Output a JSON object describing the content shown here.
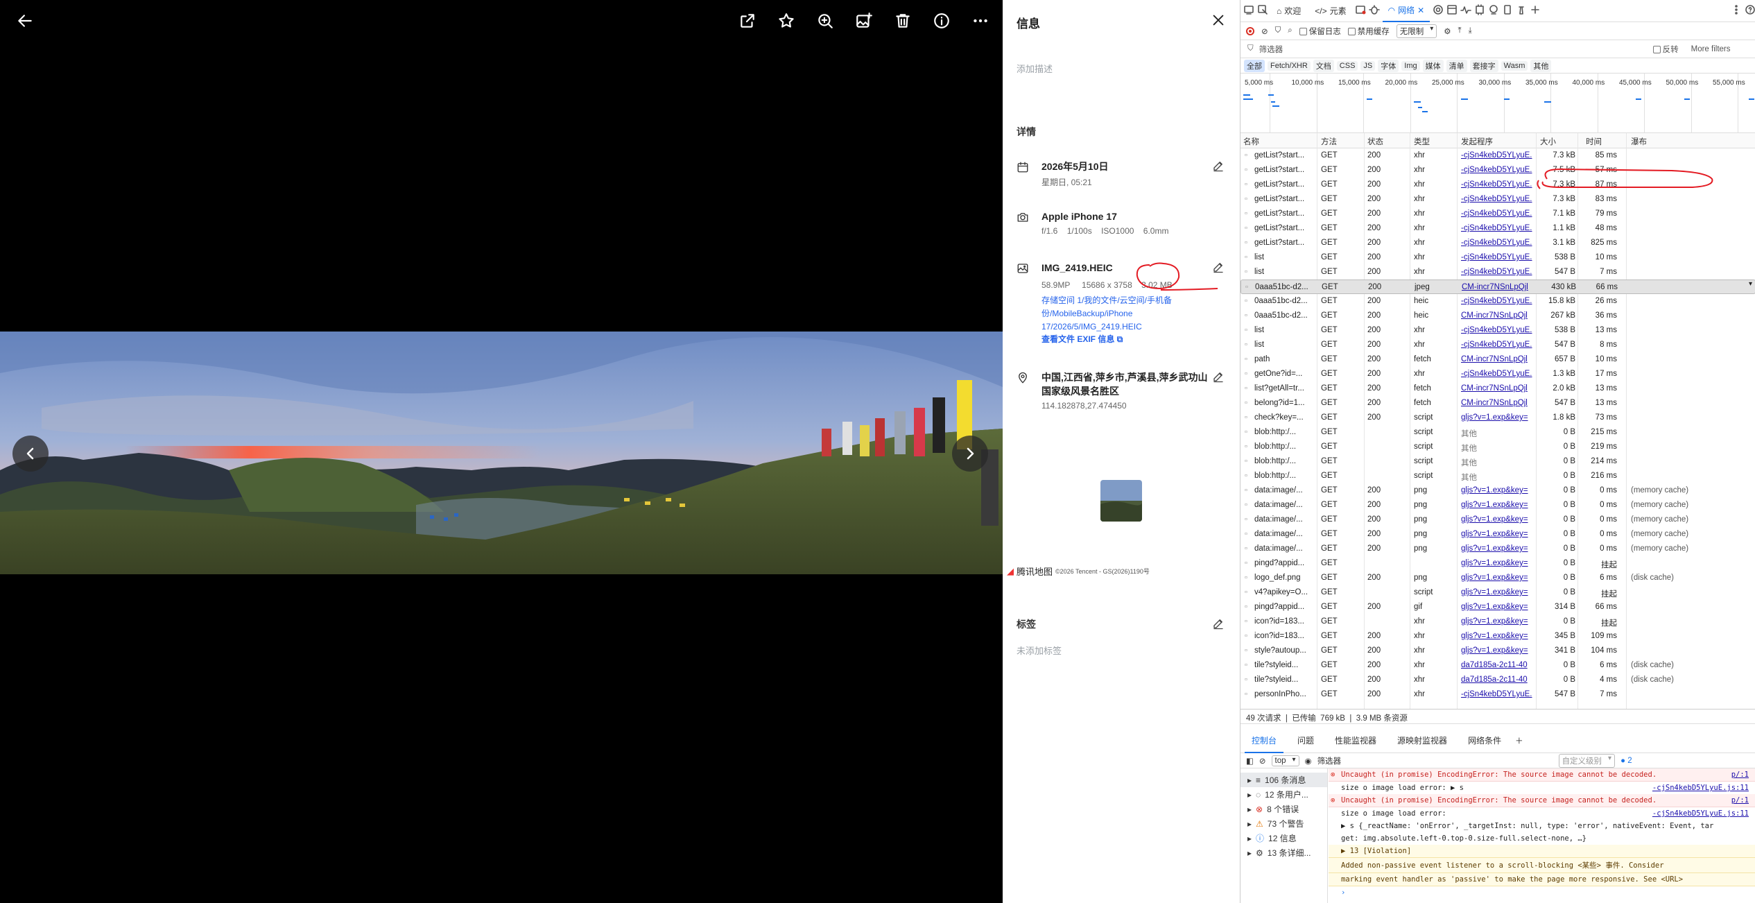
{
  "viewer": {
    "toolbar_icons": [
      "back-arrow-icon",
      "share-icon",
      "star-icon",
      "zoom-in-icon",
      "add-to-album-icon",
      "trash-icon",
      "info-icon",
      "more-icon"
    ]
  },
  "info": {
    "title": "信息",
    "description_placeholder": "添加描述",
    "details_heading": "详情",
    "date": "2026年5月10日",
    "date_sub": "星期日, 05:21",
    "camera": "Apple iPhone 17",
    "camera_params": [
      "f/1.6",
      "1/100s",
      "ISO1000",
      "6.0mm"
    ],
    "file_name": "IMG_2419.HEIC",
    "file_params": [
      "58.9MP",
      "15686 x 3758",
      "3.02 MB"
    ],
    "file_path": "存储空间 1/我的文件/云空间/手机备份/MobileBackup/iPhone 17/2026/5/IMG_2419.HEIC",
    "exif_link": "查看文件 EXIF 信息",
    "location": "中国,江西省,萍乡市,芦溪县,萍乡武功山国家级风景名胜区",
    "coords": "114.182878,27.474450",
    "map_brand": "腾讯地图",
    "map_copyright": "©2026 Tencent - GS(2026)1190号",
    "tags_heading": "标签",
    "tags_placeholder": "未添加标签"
  },
  "devtools": {
    "tabs": [
      "欢迎",
      "元素",
      "网络"
    ],
    "toolbar": {
      "preserve_log": "保留日志",
      "disable_cache": "禁用缓存",
      "throttle": "无限制"
    },
    "filter": {
      "placeholder": "筛选器",
      "invert": "反转",
      "more": "More filters"
    },
    "types": [
      "全部",
      "Fetch/XHR",
      "文档",
      "CSS",
      "JS",
      "字体",
      "Img",
      "媒体",
      "清单",
      "套接字",
      "Wasm",
      "其他"
    ],
    "timeline_ticks": [
      "5,000 ms",
      "10,000 ms",
      "15,000 ms",
      "20,000 ms",
      "25,000 ms",
      "30,000 ms",
      "35,000 ms",
      "40,000 ms",
      "45,000 ms",
      "50,000 ms",
      "55,000 ms"
    ],
    "columns": [
      "名称",
      "方法",
      "状态",
      "类型",
      "发起程序",
      "大小",
      "时间",
      "瀑布"
    ],
    "rows": [
      [
        "getList?start...",
        "GET",
        "200",
        "xhr",
        "-cjSn4kebD5YLyuE.",
        "7.3 kB",
        "85 ms",
        ""
      ],
      [
        "getList?start...",
        "GET",
        "200",
        "xhr",
        "-cjSn4kebD5YLyuE.",
        "7.5 kB",
        "57 ms",
        ""
      ],
      [
        "getList?start...",
        "GET",
        "200",
        "xhr",
        "-cjSn4kebD5YLyuE.",
        "7.3 kB",
        "87 ms",
        ""
      ],
      [
        "getList?start...",
        "GET",
        "200",
        "xhr",
        "-cjSn4kebD5YLyuE.",
        "7.3 kB",
        "83 ms",
        ""
      ],
      [
        "getList?start...",
        "GET",
        "200",
        "xhr",
        "-cjSn4kebD5YLyuE.",
        "7.1 kB",
        "79 ms",
        ""
      ],
      [
        "getList?start...",
        "GET",
        "200",
        "xhr",
        "-cjSn4kebD5YLyuE.",
        "1.1 kB",
        "48 ms",
        ""
      ],
      [
        "getList?start...",
        "GET",
        "200",
        "xhr",
        "-cjSn4kebD5YLyuE.",
        "3.1 kB",
        "825 ms",
        ""
      ],
      [
        "list",
        "GET",
        "200",
        "xhr",
        "-cjSn4kebD5YLyuE.",
        "538 B",
        "10 ms",
        ""
      ],
      [
        "list",
        "GET",
        "200",
        "xhr",
        "-cjSn4kebD5YLyuE.",
        "547 B",
        "7 ms",
        ""
      ],
      [
        "0aaa51bc-d2...",
        "GET",
        "200",
        "jpeg",
        "CM-incr7NSnLpQjl",
        "430 kB",
        "66 ms",
        ""
      ],
      [
        "0aaa51bc-d2...",
        "GET",
        "200",
        "heic",
        "-cjSn4kebD5YLyuE.",
        "15.8 kB",
        "26 ms",
        ""
      ],
      [
        "0aaa51bc-d2...",
        "GET",
        "200",
        "heic",
        "CM-incr7NSnLpQjl",
        "267 kB",
        "36 ms",
        ""
      ],
      [
        "list",
        "GET",
        "200",
        "xhr",
        "-cjSn4kebD5YLyuE.",
        "538 B",
        "13 ms",
        ""
      ],
      [
        "list",
        "GET",
        "200",
        "xhr",
        "-cjSn4kebD5YLyuE.",
        "547 B",
        "8 ms",
        ""
      ],
      [
        "path",
        "GET",
        "200",
        "fetch",
        "CM-incr7NSnLpQjl",
        "657 B",
        "10 ms",
        ""
      ],
      [
        "getOne?id=...",
        "GET",
        "200",
        "xhr",
        "-cjSn4kebD5YLyuE.",
        "1.3 kB",
        "17 ms",
        ""
      ],
      [
        "list?getAll=tr...",
        "GET",
        "200",
        "fetch",
        "CM-incr7NSnLpQjl",
        "2.0 kB",
        "13 ms",
        ""
      ],
      [
        "belong?id=1...",
        "GET",
        "200",
        "fetch",
        "CM-incr7NSnLpQjl",
        "547 B",
        "13 ms",
        ""
      ],
      [
        "check?key=...",
        "GET",
        "200",
        "script",
        "gljs?v=1.exp&key=",
        "1.8 kB",
        "73 ms",
        ""
      ],
      [
        "blob:http:/...",
        "GET",
        "",
        "script",
        "其他",
        "0 B",
        "215 ms",
        ""
      ],
      [
        "blob:http:/...",
        "GET",
        "",
        "script",
        "其他",
        "0 B",
        "219 ms",
        ""
      ],
      [
        "blob:http:/...",
        "GET",
        "",
        "script",
        "其他",
        "0 B",
        "214 ms",
        ""
      ],
      [
        "blob:http:/...",
        "GET",
        "",
        "script",
        "其他",
        "0 B",
        "216 ms",
        ""
      ],
      [
        "data:image/...",
        "GET",
        "200",
        "png",
        "gljs?v=1.exp&key=",
        "0 B",
        "0 ms",
        "(memory cache)"
      ],
      [
        "data:image/...",
        "GET",
        "200",
        "png",
        "gljs?v=1.exp&key=",
        "0 B",
        "0 ms",
        "(memory cache)"
      ],
      [
        "data:image/...",
        "GET",
        "200",
        "png",
        "gljs?v=1.exp&key=",
        "0 B",
        "0 ms",
        "(memory cache)"
      ],
      [
        "data:image/...",
        "GET",
        "200",
        "png",
        "gljs?v=1.exp&key=",
        "0 B",
        "0 ms",
        "(memory cache)"
      ],
      [
        "data:image/...",
        "GET",
        "200",
        "png",
        "gljs?v=1.exp&key=",
        "0 B",
        "0 ms",
        "(memory cache)"
      ],
      [
        "pingd?appid...",
        "GET",
        "",
        "",
        "gljs?v=1.exp&key=",
        "0 B",
        "挂起",
        ""
      ],
      [
        "logo_def.png",
        "GET",
        "200",
        "png",
        "gljs?v=1.exp&key=",
        "0 B",
        "6 ms",
        "(disk cache)"
      ],
      [
        "v4?apikey=O...",
        "GET",
        "",
        "script",
        "gljs?v=1.exp&key=",
        "0 B",
        "挂起",
        ""
      ],
      [
        "pingd?appid...",
        "GET",
        "200",
        "gif",
        "gljs?v=1.exp&key=",
        "314 B",
        "66 ms",
        ""
      ],
      [
        "icon?id=183...",
        "GET",
        "",
        "xhr",
        "gljs?v=1.exp&key=",
        "0 B",
        "挂起",
        ""
      ],
      [
        "icon?id=183...",
        "GET",
        "200",
        "xhr",
        "gljs?v=1.exp&key=",
        "345 B",
        "109 ms",
        ""
      ],
      [
        "style?autoup...",
        "GET",
        "200",
        "xhr",
        "gljs?v=1.exp&key=",
        "341 B",
        "104 ms",
        ""
      ],
      [
        "tile?styleid...",
        "GET",
        "200",
        "xhr",
        "da7d185a-2c11-40",
        "0 B",
        "6 ms",
        "(disk cache)"
      ],
      [
        "tile?styleid...",
        "GET",
        "200",
        "xhr",
        "da7d185a-2c11-40",
        "0 B",
        "4 ms",
        "(disk cache)"
      ],
      [
        "personInPho...",
        "GET",
        "200",
        "xhr",
        "-cjSn4kebD5YLyuE.",
        "547 B",
        "7 ms",
        ""
      ]
    ],
    "selected_row": 9,
    "summary": {
      "requests": "49 次请求",
      "transferred_label": "已传输",
      "transferred": "769 kB",
      "resources": "3.9 MB 条资源"
    },
    "console_tabs": [
      "控制台",
      "问题",
      "性能监视器",
      "源映射监视器",
      "网络条件"
    ],
    "console_toolbar": {
      "context": "top",
      "filter": "筛选器",
      "levels": "自定义级别",
      "issues_count": "2"
    },
    "console_sidebar": [
      "106 条消息",
      "12 条用户...",
      "8 个错误",
      "73 个警告",
      "12 信息",
      "13 条详细..."
    ],
    "console_lines": [
      {
        "kind": "err",
        "text": "Uncaught (in promise) EncodingError: The source image cannot be decoded.",
        "src": "p/:1"
      },
      {
        "kind": "plain",
        "text": "size o image load error:  ▶ s",
        "src": "-cjSn4kebD5YLyuE.js:11"
      },
      {
        "kind": "err",
        "text": "Uncaught (in promise) EncodingError: The source image cannot be decoded.",
        "src": "p/:1"
      },
      {
        "kind": "plain",
        "text": "size o image load error:",
        "src": "-cjSn4kebD5YLyuE.js:11"
      },
      {
        "kind": "plain",
        "text": "▶ s {_reactName: 'onError', _targetInst: null, type: 'error', nativeEvent: Event, tar",
        "src": ""
      },
      {
        "kind": "plain",
        "text": "   get: img.absolute.left-0.top-0.size-full.select-none, …}",
        "src": ""
      },
      {
        "kind": "warn",
        "text": "▶ 13  [Violation]",
        "src": ""
      },
      {
        "kind": "warn",
        "text": "      Added non-passive event listener to a scroll-blocking <某些> 事件. Consider",
        "src": ""
      },
      {
        "kind": "warn",
        "text": "   marking event handler as 'passive' to make the page more responsive. See <URL>",
        "src": ""
      }
    ]
  }
}
